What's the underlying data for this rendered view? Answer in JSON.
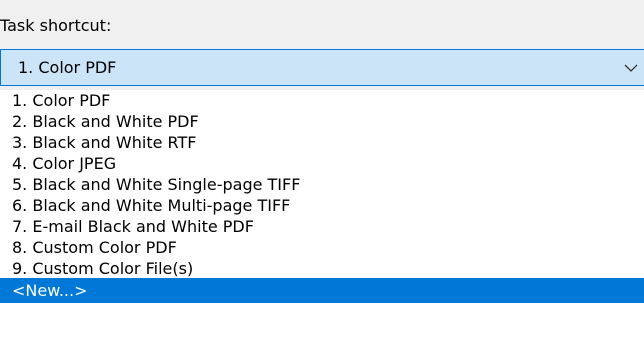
{
  "label": "Task shortcut:",
  "combo": {
    "selected": "1. Color PDF",
    "arrow_icon": "chevron-down-icon"
  },
  "options": [
    "1. Color PDF",
    "2. Black and White PDF",
    "3. Black and White RTF",
    "4. Color JPEG",
    "5. Black and White Single-page TIFF",
    "6. Black and White Multi-page TIFF",
    "7. E-mail Black and White PDF",
    "8. Custom Color PDF",
    "9. Custom Color File(s)",
    "<New...>"
  ],
  "highlighted_option": "<New...>",
  "colors": {
    "selection": "#0078d7",
    "combo_background": "#cce4f7",
    "combo_border": "#0078d7",
    "list_background": "#ffffff",
    "window_background": "#f0f0f0"
  }
}
